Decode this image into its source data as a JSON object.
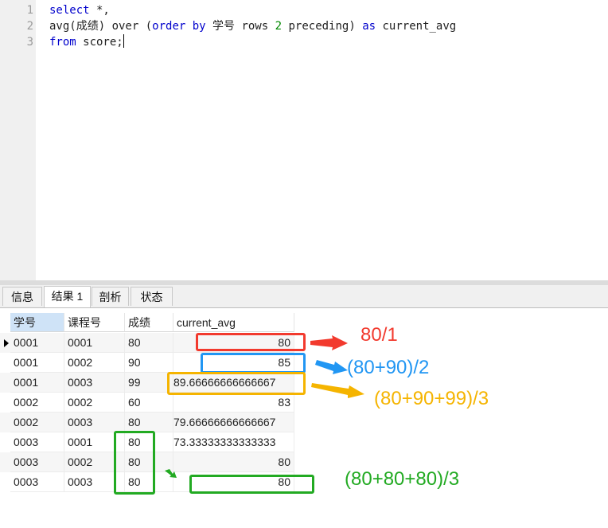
{
  "editor": {
    "line_numbers": [
      "1",
      "2",
      "3"
    ],
    "line1": {
      "kw": "select",
      "rest": " *,"
    },
    "line2": {
      "a": "avg(成绩) over (",
      "b": "order by",
      "c": " 学号 rows ",
      "d": "2",
      "e": " preceding) ",
      "f": "as",
      "g": " current_avg"
    },
    "line3": {
      "kw": "from",
      "rest": " score;"
    }
  },
  "tabs": [
    {
      "label": "信息"
    },
    {
      "label": "结果 1"
    },
    {
      "label": "剖析"
    },
    {
      "label": "状态"
    }
  ],
  "grid": {
    "columns": [
      "学号",
      "课程号",
      "成绩",
      "current_avg"
    ],
    "rows": [
      [
        "0001",
        "0001",
        "80",
        "80"
      ],
      [
        "0001",
        "0002",
        "90",
        "85"
      ],
      [
        "0001",
        "0003",
        "99",
        "89.66666666666667"
      ],
      [
        "0002",
        "0002",
        "60",
        "83"
      ],
      [
        "0002",
        "0003",
        "80",
        "79.66666666666667"
      ],
      [
        "0003",
        "0001",
        "80",
        "73.33333333333333"
      ],
      [
        "0003",
        "0002",
        "80",
        "80"
      ],
      [
        "0003",
        "0003",
        "80",
        "80"
      ]
    ]
  },
  "annotations": [
    {
      "text": "80/1",
      "color": "#f23a2e"
    },
    {
      "text": "(80+90)/2",
      "color": "#2196f3"
    },
    {
      "text": "(80+90+99)/3",
      "color": "#f5b400"
    },
    {
      "text": "(80+80+80)/3",
      "color": "#22aa22"
    }
  ],
  "colors": {
    "red": "#f23a2e",
    "blue": "#2196f3",
    "yellow": "#f5b400",
    "green": "#22aa22",
    "keyword": "#0000cc",
    "number": "#008800"
  }
}
